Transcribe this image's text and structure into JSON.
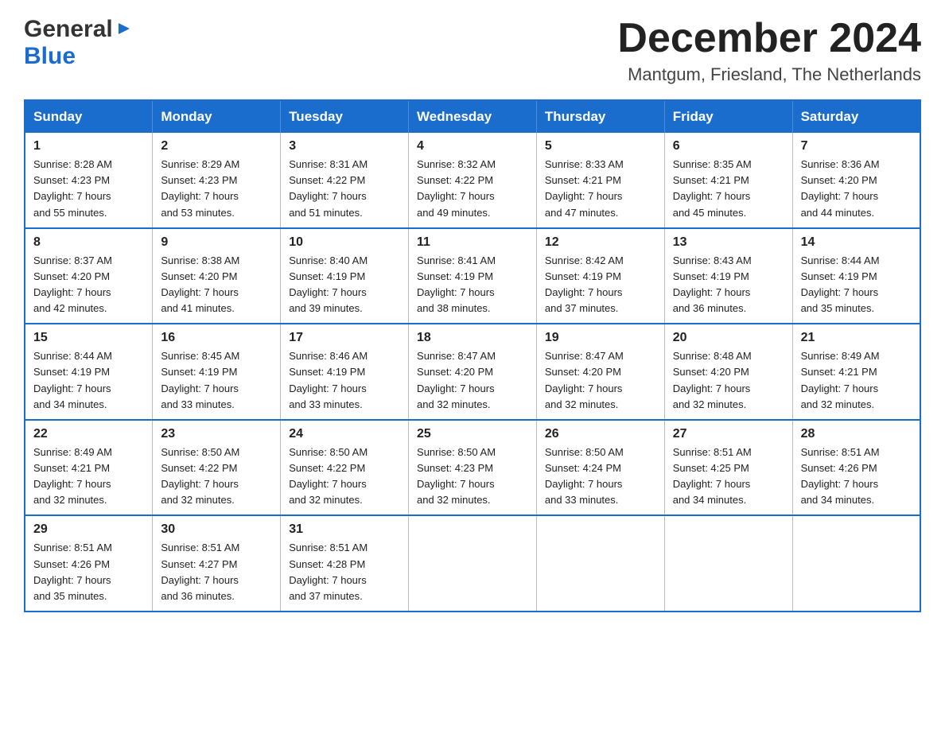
{
  "header": {
    "logo_general": "General",
    "logo_blue": "Blue",
    "month_title": "December 2024",
    "location": "Mantgum, Friesland, The Netherlands"
  },
  "days_of_week": [
    "Sunday",
    "Monday",
    "Tuesday",
    "Wednesday",
    "Thursday",
    "Friday",
    "Saturday"
  ],
  "weeks": [
    [
      {
        "day": "1",
        "sunrise": "8:28 AM",
        "sunset": "4:23 PM",
        "daylight": "7 hours and 55 minutes."
      },
      {
        "day": "2",
        "sunrise": "8:29 AM",
        "sunset": "4:23 PM",
        "daylight": "7 hours and 53 minutes."
      },
      {
        "day": "3",
        "sunrise": "8:31 AM",
        "sunset": "4:22 PM",
        "daylight": "7 hours and 51 minutes."
      },
      {
        "day": "4",
        "sunrise": "8:32 AM",
        "sunset": "4:22 PM",
        "daylight": "7 hours and 49 minutes."
      },
      {
        "day": "5",
        "sunrise": "8:33 AM",
        "sunset": "4:21 PM",
        "daylight": "7 hours and 47 minutes."
      },
      {
        "day": "6",
        "sunrise": "8:35 AM",
        "sunset": "4:21 PM",
        "daylight": "7 hours and 45 minutes."
      },
      {
        "day": "7",
        "sunrise": "8:36 AM",
        "sunset": "4:20 PM",
        "daylight": "7 hours and 44 minutes."
      }
    ],
    [
      {
        "day": "8",
        "sunrise": "8:37 AM",
        "sunset": "4:20 PM",
        "daylight": "7 hours and 42 minutes."
      },
      {
        "day": "9",
        "sunrise": "8:38 AM",
        "sunset": "4:20 PM",
        "daylight": "7 hours and 41 minutes."
      },
      {
        "day": "10",
        "sunrise": "8:40 AM",
        "sunset": "4:19 PM",
        "daylight": "7 hours and 39 minutes."
      },
      {
        "day": "11",
        "sunrise": "8:41 AM",
        "sunset": "4:19 PM",
        "daylight": "7 hours and 38 minutes."
      },
      {
        "day": "12",
        "sunrise": "8:42 AM",
        "sunset": "4:19 PM",
        "daylight": "7 hours and 37 minutes."
      },
      {
        "day": "13",
        "sunrise": "8:43 AM",
        "sunset": "4:19 PM",
        "daylight": "7 hours and 36 minutes."
      },
      {
        "day": "14",
        "sunrise": "8:44 AM",
        "sunset": "4:19 PM",
        "daylight": "7 hours and 35 minutes."
      }
    ],
    [
      {
        "day": "15",
        "sunrise": "8:44 AM",
        "sunset": "4:19 PM",
        "daylight": "7 hours and 34 minutes."
      },
      {
        "day": "16",
        "sunrise": "8:45 AM",
        "sunset": "4:19 PM",
        "daylight": "7 hours and 33 minutes."
      },
      {
        "day": "17",
        "sunrise": "8:46 AM",
        "sunset": "4:19 PM",
        "daylight": "7 hours and 33 minutes."
      },
      {
        "day": "18",
        "sunrise": "8:47 AM",
        "sunset": "4:20 PM",
        "daylight": "7 hours and 32 minutes."
      },
      {
        "day": "19",
        "sunrise": "8:47 AM",
        "sunset": "4:20 PM",
        "daylight": "7 hours and 32 minutes."
      },
      {
        "day": "20",
        "sunrise": "8:48 AM",
        "sunset": "4:20 PM",
        "daylight": "7 hours and 32 minutes."
      },
      {
        "day": "21",
        "sunrise": "8:49 AM",
        "sunset": "4:21 PM",
        "daylight": "7 hours and 32 minutes."
      }
    ],
    [
      {
        "day": "22",
        "sunrise": "8:49 AM",
        "sunset": "4:21 PM",
        "daylight": "7 hours and 32 minutes."
      },
      {
        "day": "23",
        "sunrise": "8:50 AM",
        "sunset": "4:22 PM",
        "daylight": "7 hours and 32 minutes."
      },
      {
        "day": "24",
        "sunrise": "8:50 AM",
        "sunset": "4:22 PM",
        "daylight": "7 hours and 32 minutes."
      },
      {
        "day": "25",
        "sunrise": "8:50 AM",
        "sunset": "4:23 PM",
        "daylight": "7 hours and 32 minutes."
      },
      {
        "day": "26",
        "sunrise": "8:50 AM",
        "sunset": "4:24 PM",
        "daylight": "7 hours and 33 minutes."
      },
      {
        "day": "27",
        "sunrise": "8:51 AM",
        "sunset": "4:25 PM",
        "daylight": "7 hours and 34 minutes."
      },
      {
        "day": "28",
        "sunrise": "8:51 AM",
        "sunset": "4:26 PM",
        "daylight": "7 hours and 34 minutes."
      }
    ],
    [
      {
        "day": "29",
        "sunrise": "8:51 AM",
        "sunset": "4:26 PM",
        "daylight": "7 hours and 35 minutes."
      },
      {
        "day": "30",
        "sunrise": "8:51 AM",
        "sunset": "4:27 PM",
        "daylight": "7 hours and 36 minutes."
      },
      {
        "day": "31",
        "sunrise": "8:51 AM",
        "sunset": "4:28 PM",
        "daylight": "7 hours and 37 minutes."
      },
      null,
      null,
      null,
      null
    ]
  ],
  "labels": {
    "sunrise": "Sunrise:",
    "sunset": "Sunset:",
    "daylight": "Daylight:"
  }
}
